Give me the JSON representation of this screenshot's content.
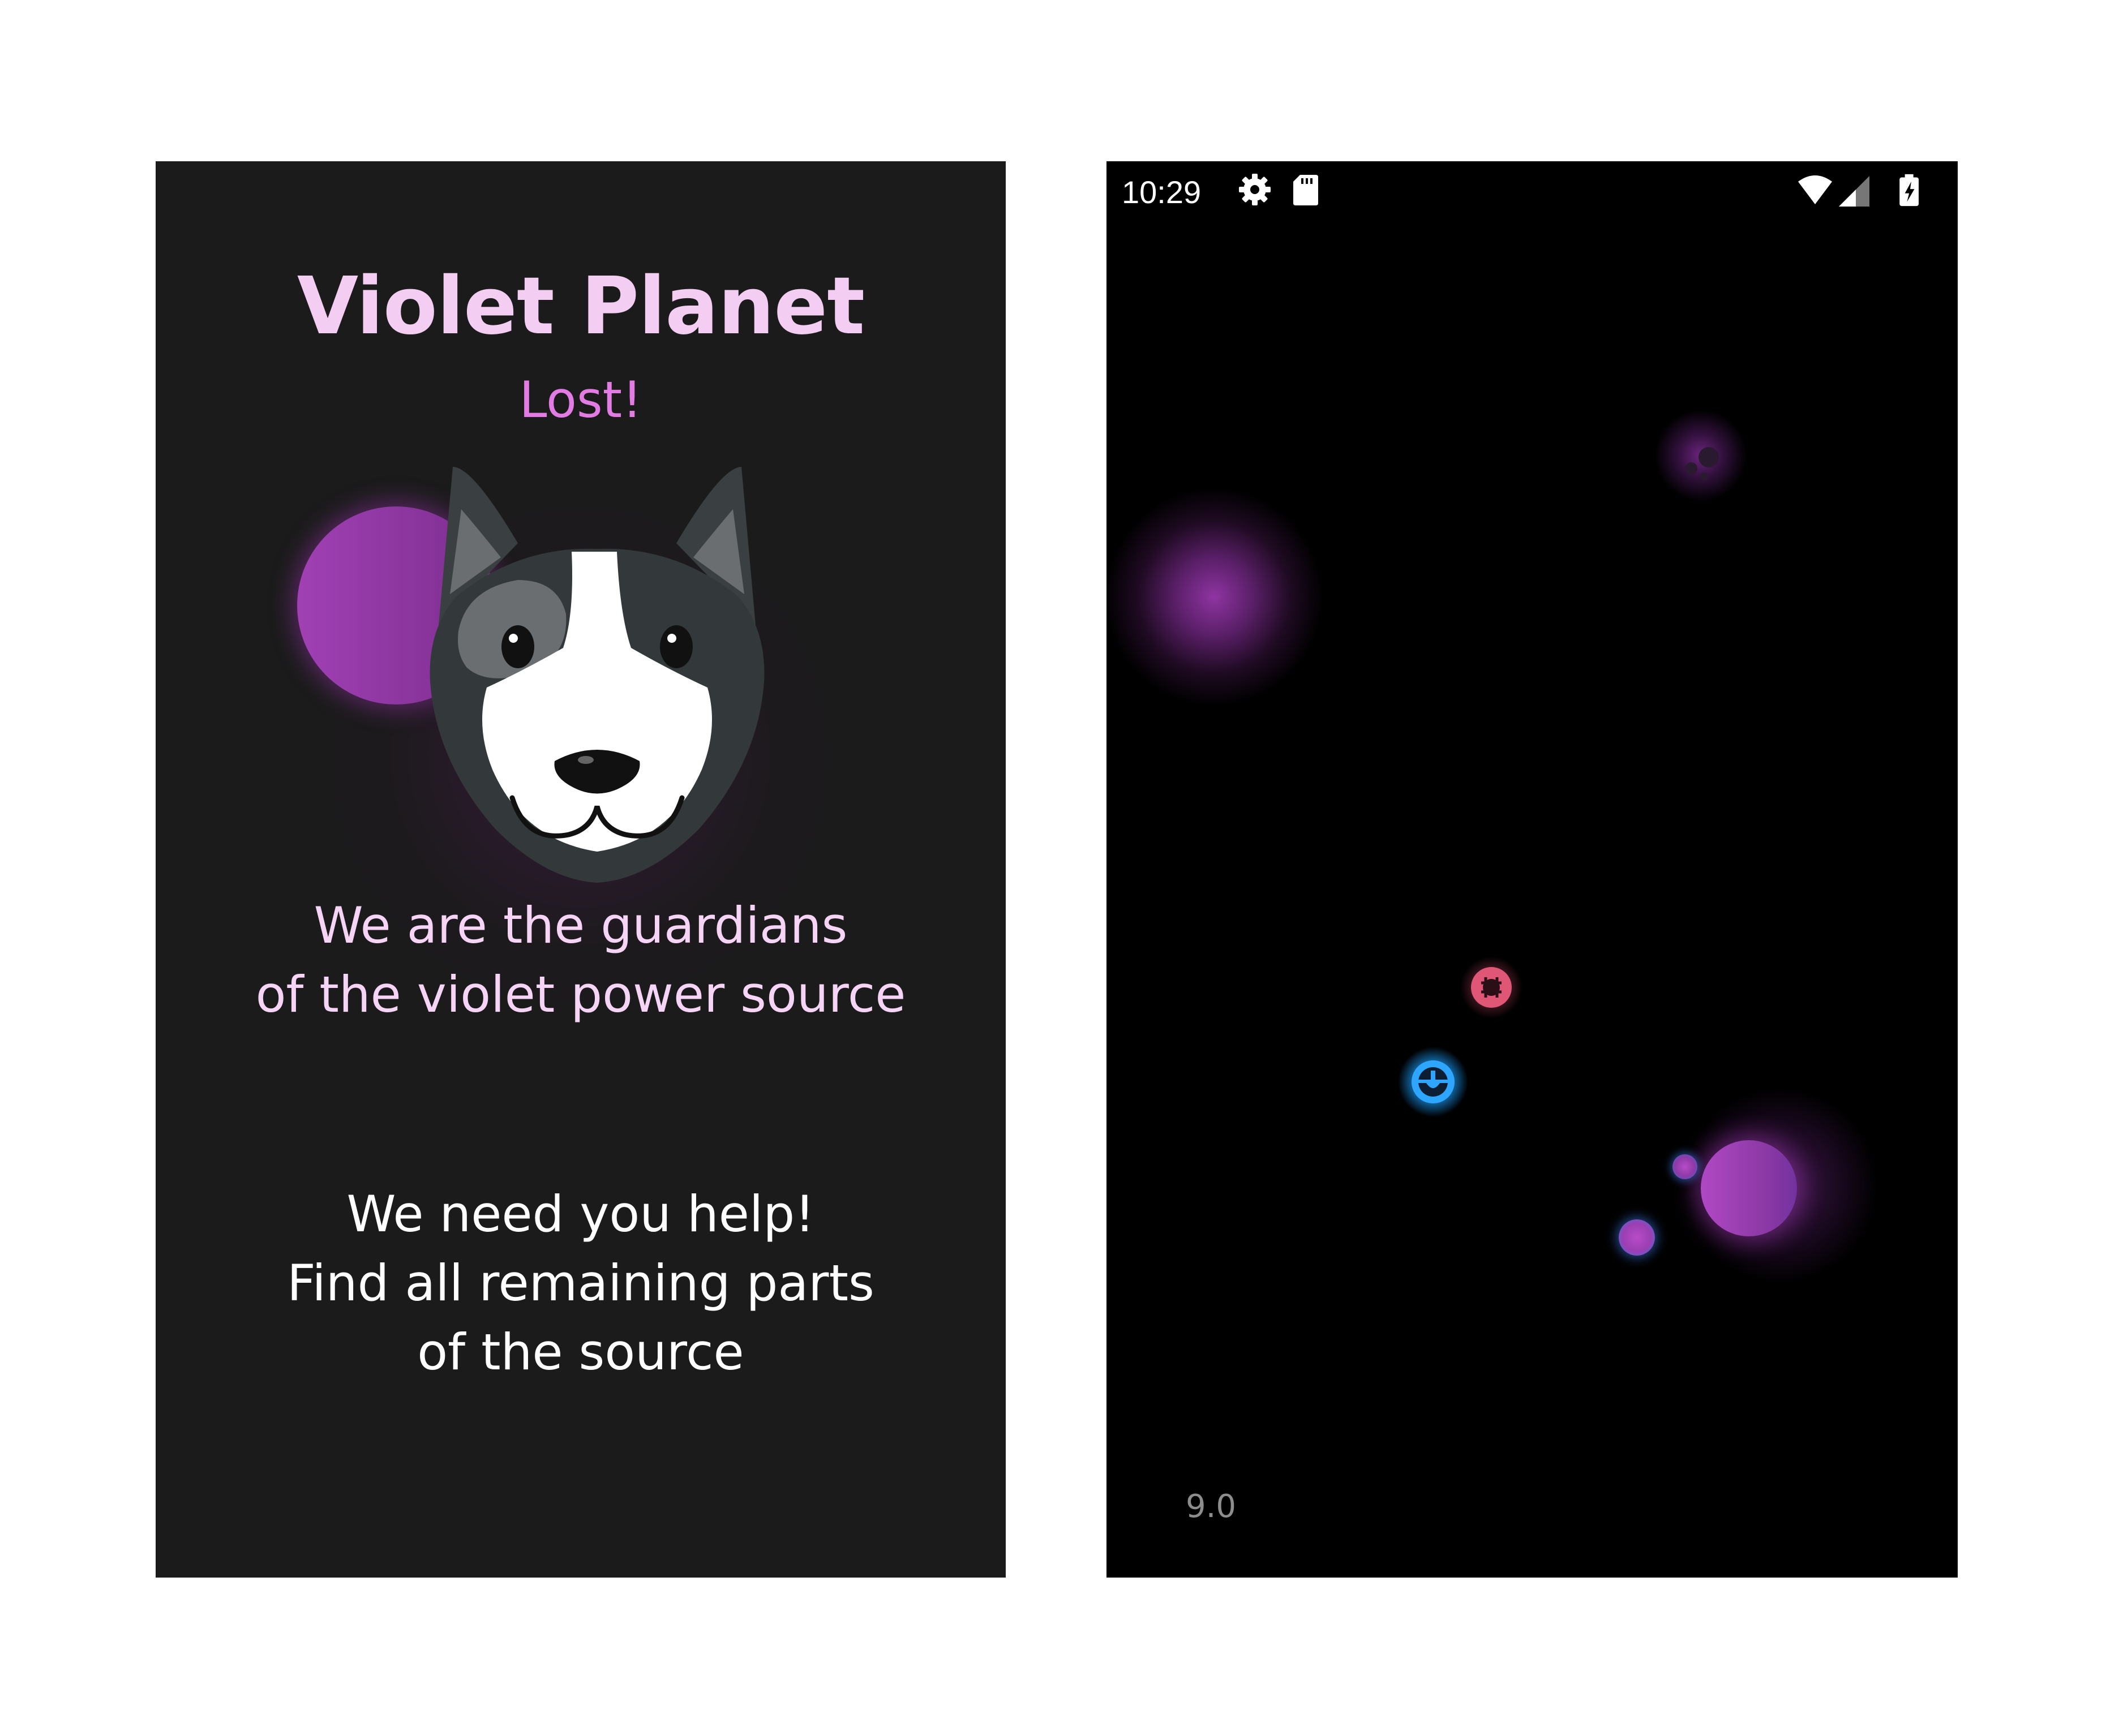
{
  "intro": {
    "title": "Violet Planet",
    "subtitle": "Lost!",
    "lore": "We are the guardians\nof the violet power source",
    "instructions": "We need you help!\nFind all remaining parts\nof the source",
    "colors": {
      "background": "#1b1b1b",
      "title": "#f4cdf3",
      "subtitle": "#e27ce4",
      "lore": "#f6d4f5",
      "instructions": "#ffffff",
      "planet": "#a040b4"
    },
    "illustration": "dog-face"
  },
  "game": {
    "status_bar": {
      "time": "10:29",
      "icons": [
        "settings-icon",
        "sdcard-icon",
        "wifi-icon",
        "signal-icon",
        "battery-charging-icon"
      ]
    },
    "score": "9.0",
    "colors": {
      "background": "#000000",
      "planet": "#9a3cb0",
      "enemy": "#e05070",
      "player": "#2aa0ff",
      "score": "#8d8d8d"
    }
  }
}
